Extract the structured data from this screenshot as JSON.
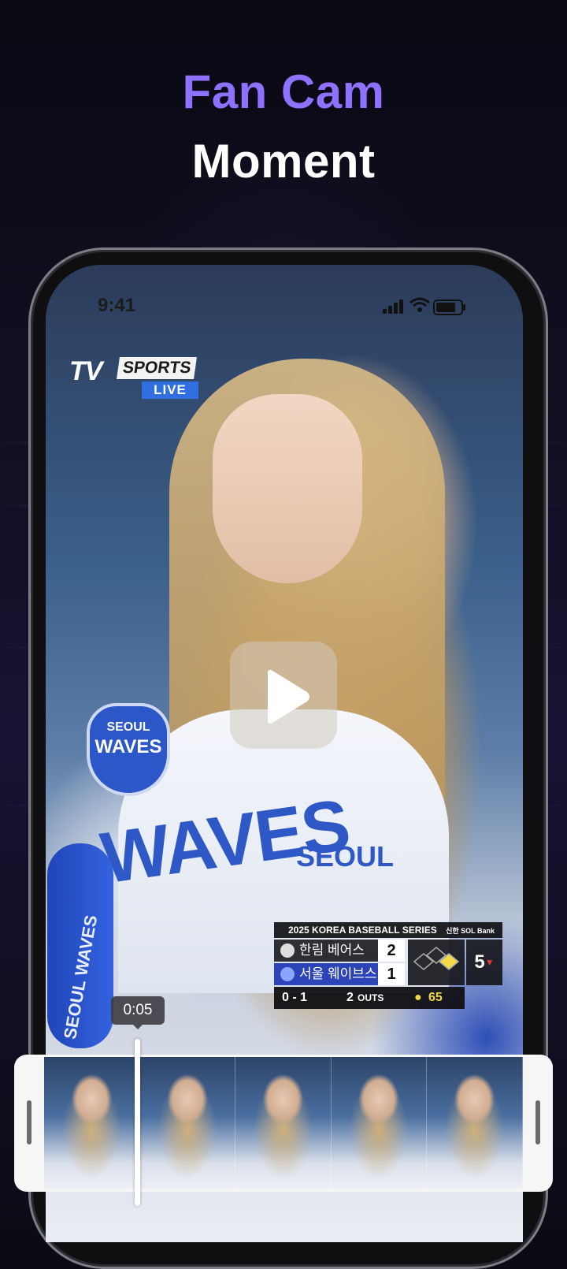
{
  "headline": {
    "line1": "Fan Cam",
    "line2": "Moment"
  },
  "status_bar": {
    "time": "9:41"
  },
  "broadcast": {
    "brand_tv": "TV",
    "brand_sports": "SPORTS",
    "live_label": "LIVE"
  },
  "jersey": {
    "front_text": "WAVES",
    "seoul_text": "SEOUL",
    "badge_line1": "SEOUL",
    "badge_line2": "WAVES",
    "bat_text": "SEOUL WAVES"
  },
  "scoreboard": {
    "title": "2025 KOREA BASEBALL SERIES",
    "sponsor": "신한 SOL Bank Field",
    "team1_name": "한림 베어스",
    "team1_score": "2",
    "team2_name": "서울 웨이브스",
    "team2_score": "1",
    "inning": "5",
    "count": "0 - 1",
    "outs_number": "2",
    "outs_label": "OUTS",
    "pitch_count": "65"
  },
  "player": {
    "current_time": "0:05",
    "thumbnail_count": 5
  },
  "colors": {
    "accent": "#8e72ff",
    "live_blue": "#2f6fe0",
    "team_blue": "#2b44b8"
  }
}
